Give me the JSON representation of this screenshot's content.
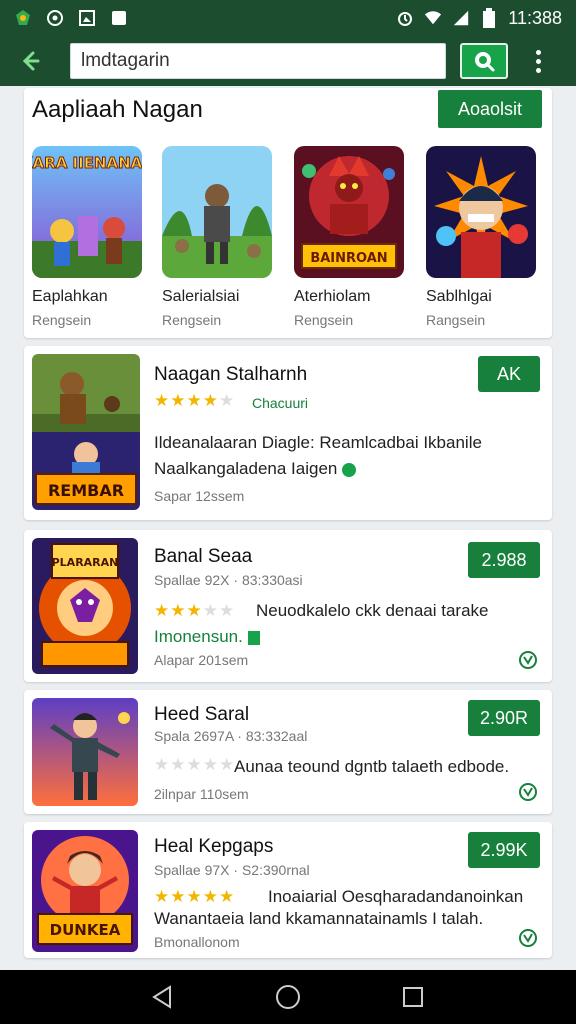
{
  "status": {
    "time": "11:388"
  },
  "search": {
    "value": "lmdtagarin"
  },
  "featured": {
    "title": "Aapliaah Nagan",
    "more_label": "Aoaolsit",
    "tiles": [
      {
        "name": "Eaplahkan",
        "sub": "Rengsein",
        "art_title": "KARA IIENANAS"
      },
      {
        "name": "Salerialsiai",
        "sub": "Rengsein"
      },
      {
        "name": "Aterhiolam",
        "sub": "Rengsein",
        "art_title": "BAINROAN"
      },
      {
        "name": "Sablhlgai",
        "sub": "Rangsein"
      }
    ]
  },
  "apps": [
    {
      "title": "Naagan Stalharnh",
      "tag": "Chacuuri",
      "desc_line1": "Ildeanalaaran Diagle: Reamlcadbai Ikbanile",
      "desc_line2": "Naalkangaladena Iaigen",
      "footer": "Sapar 12ssem",
      "price": "AK",
      "rating": 4,
      "art_title": "REMBAR"
    },
    {
      "title": "Banal Seaa",
      "meta": "Spallae 92X · 83:330asi",
      "desc_line1": "Neuodkalelo ckk denaai tarake",
      "desc_line2": "Imonensun.",
      "footer": "Alapar 201sem",
      "price": "2.988",
      "rating": 3,
      "art_title": "PLARARAN"
    },
    {
      "title": "Heed Saral",
      "meta": "Spala 2697A · 83:332aal",
      "desc_line1": "Aunaa teound dgntb talaeth edbode.",
      "footer": "2ilnpar 110sem",
      "price": "2.90R",
      "rating": 0
    },
    {
      "title": "Heal Kepgaps",
      "meta": "Spallae 97X · S2:390rnal",
      "desc_line1": "Inoaiarial Oesqharadandanoinkan",
      "desc_line2": "Wanantaeia land kkamannatainamls I talah.",
      "footer": "Bmonallonom",
      "price": "2.99K",
      "rating": 5,
      "art_title": "DUNKEA"
    }
  ],
  "colors": {
    "bar": "#1b4d2e",
    "accent": "#16803c",
    "star": "#f4b400"
  }
}
